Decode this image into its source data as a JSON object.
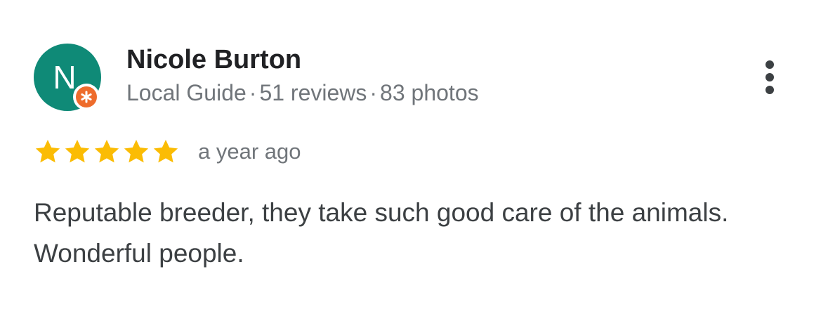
{
  "reviewer": {
    "initial": "N",
    "name": "Nicole Burton",
    "badge": "Local Guide",
    "reviews": "51 reviews",
    "photos": "83 photos",
    "separator": "·",
    "avatar_color": "#0f8a77",
    "badge_color": "#ee6c2c"
  },
  "review": {
    "rating": 5,
    "max_rating": 5,
    "star_color": "#fbbc04",
    "time": "a year ago",
    "text": "Reputable breeder, they take such good care of the animals. Wonderful people."
  },
  "icons": {
    "more": "more-vert-icon",
    "star": "star-icon",
    "local_guide": "local-guide-badge-icon"
  }
}
